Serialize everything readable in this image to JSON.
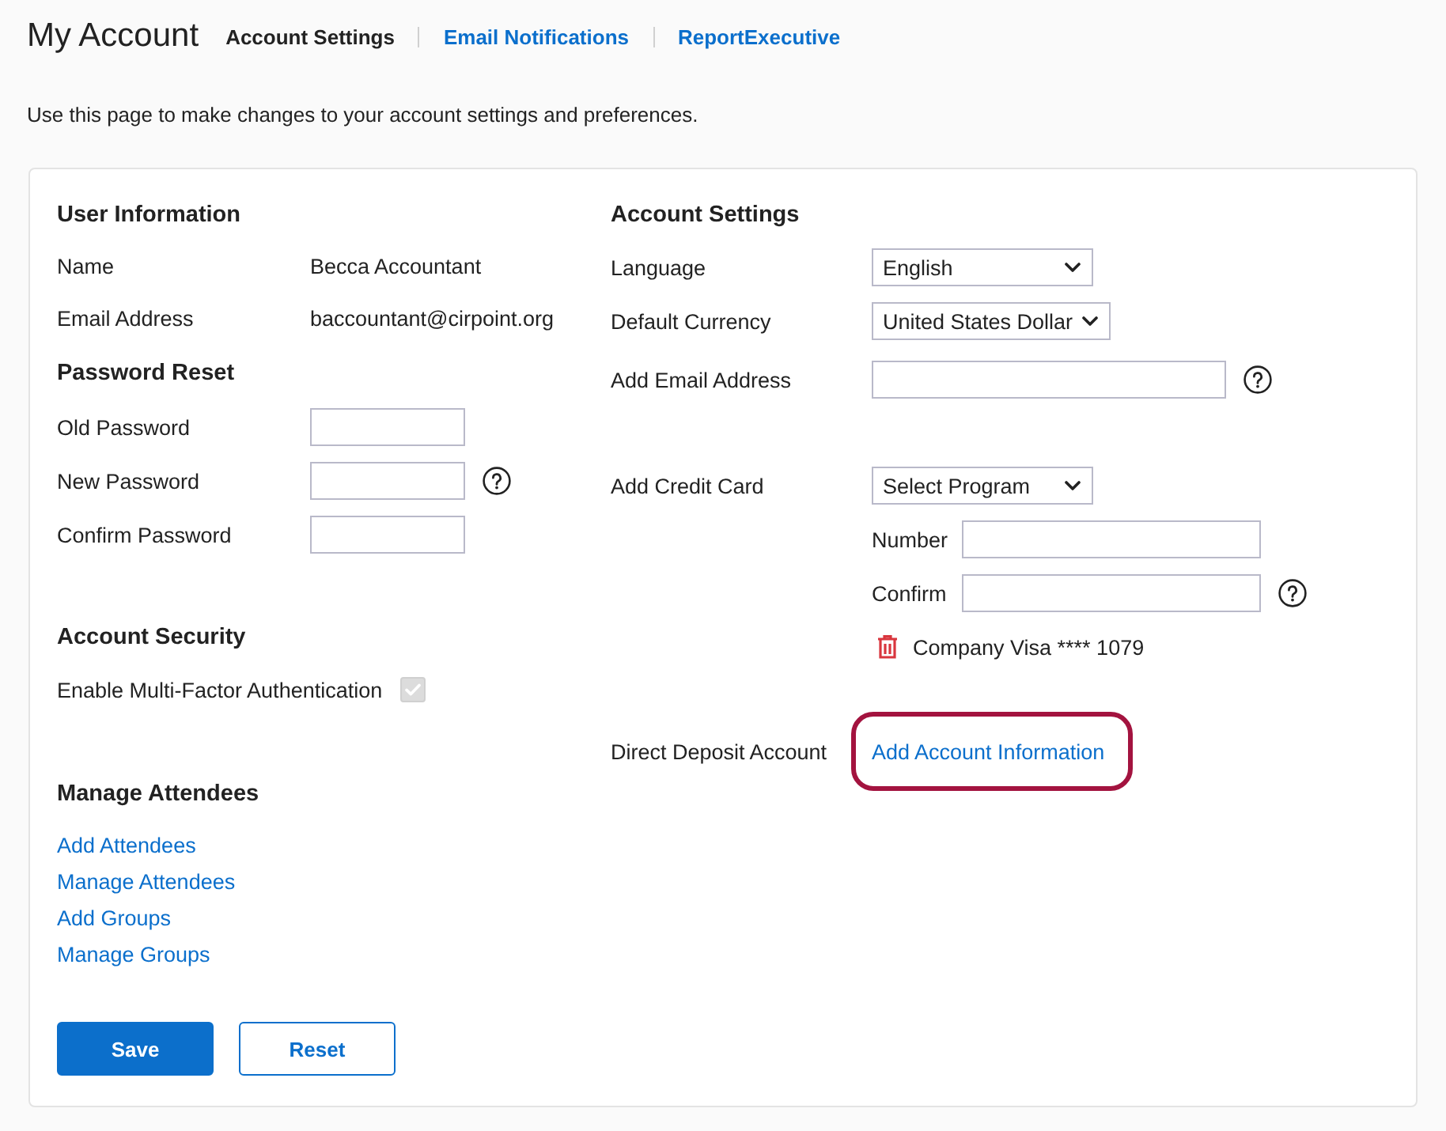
{
  "page": {
    "title": "My Account",
    "tabs": [
      {
        "label": "Account Settings",
        "selected": true
      },
      {
        "label": "Email Notifications",
        "selected": false
      },
      {
        "label": "ReportExecutive",
        "selected": false
      }
    ],
    "description": "Use this page to make changes to your account settings and preferences."
  },
  "user_information": {
    "heading": "User Information",
    "rows": [
      {
        "label": "Name",
        "value": "Becca Accountant"
      },
      {
        "label": "Email Address",
        "value": "baccountant@cirpoint.org"
      }
    ]
  },
  "password_reset": {
    "heading": "Password Reset",
    "fields": [
      {
        "label": "Old Password",
        "help": false
      },
      {
        "label": "New Password",
        "help": true
      },
      {
        "label": "Confirm Password",
        "help": false
      }
    ]
  },
  "account_security": {
    "heading": "Account Security",
    "mfa": {
      "label": "Enable Multi-Factor Authentication",
      "checked": true,
      "disabled": true
    }
  },
  "manage_attendees": {
    "heading": "Manage Attendees",
    "links": [
      "Add Attendees",
      "Manage Attendees",
      "Add Groups",
      "Manage Groups"
    ]
  },
  "buttons": [
    {
      "label": "Save",
      "kind": "primary"
    },
    {
      "label": "Reset",
      "kind": "secondary"
    }
  ],
  "account_settings": {
    "heading": "Account Settings",
    "language": {
      "label": "Language",
      "value": "English"
    },
    "currency": {
      "label": "Default Currency",
      "value": "United States Dollar"
    },
    "add_email": {
      "label": "Add Email Address",
      "help": true
    },
    "credit_card": {
      "label": "Add Credit Card",
      "program": "Select Program",
      "number": {
        "label": "Number",
        "help": false
      },
      "confirm": {
        "label": "Confirm",
        "help": true
      },
      "saved_card": "Company Visa **** 1079"
    },
    "direct_deposit": {
      "label": "Direct Deposit Account",
      "link": "Add Account Information",
      "highlighted": true
    }
  }
}
